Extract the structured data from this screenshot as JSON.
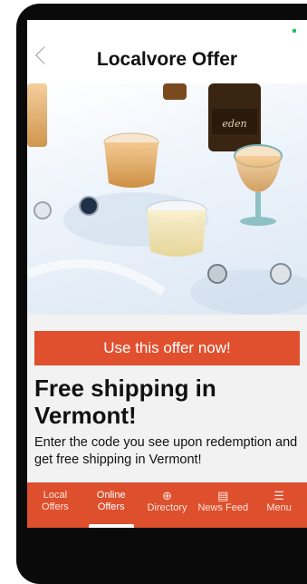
{
  "header": {
    "title": "Localvore Offer",
    "back_icon": "chevron-left-icon"
  },
  "hero": {
    "bottle_label": "eden"
  },
  "offer": {
    "cta_label": "Use this offer now!",
    "headline": "Free shipping in Vermont!",
    "description": "Enter the code you see upon redemption and get free shipping in Vermont!"
  },
  "tabs": [
    {
      "label_line1": "Local",
      "label_line2": "Offers",
      "icon": ""
    },
    {
      "label_line1": "Online",
      "label_line2": "Offers",
      "icon": "",
      "active": true
    },
    {
      "label_line1": "Directory",
      "label_line2": "",
      "icon": "globe-icon"
    },
    {
      "label_line1": "News Feed",
      "label_line2": "",
      "icon": "newspaper-icon"
    },
    {
      "label_line1": "Menu",
      "label_line2": "",
      "icon": "menu-icon"
    }
  ],
  "colors": {
    "accent": "#e0502f",
    "tabbar": "#dd4f2d",
    "status": "#1bc45a"
  }
}
